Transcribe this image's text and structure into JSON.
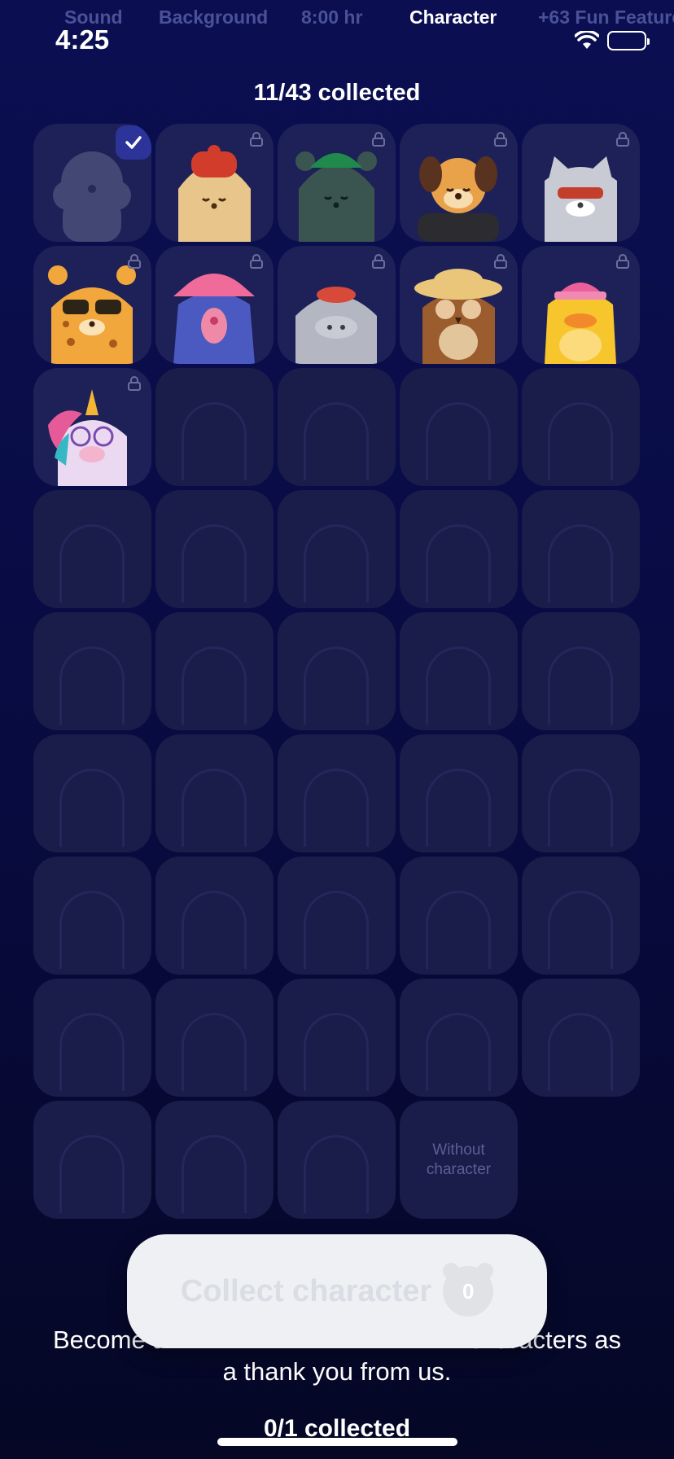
{
  "top_tabs": [
    {
      "label": "Sound",
      "active": false
    },
    {
      "label": "Background",
      "active": false
    },
    {
      "label": "8:00 hr",
      "active": false
    },
    {
      "label": "Character",
      "active": true
    },
    {
      "label": "+63 Fun Features",
      "active": false
    }
  ],
  "status_bar": {
    "time": "4:25"
  },
  "collection": {
    "title": "11/43 collected"
  },
  "characters": [
    {
      "name": "gray-poodle",
      "state": "selected"
    },
    {
      "name": "hedgehog-red-beanie",
      "state": "locked"
    },
    {
      "name": "panther-green-cap",
      "state": "locked"
    },
    {
      "name": "dog-leather-jacket",
      "state": "locked"
    },
    {
      "name": "cat-sunglasses",
      "state": "locked"
    },
    {
      "name": "leopard-glasses",
      "state": "locked"
    },
    {
      "name": "blue-bird-pink-hat",
      "state": "locked"
    },
    {
      "name": "hippo-red-beret",
      "state": "locked"
    },
    {
      "name": "owl-straw-hat",
      "state": "locked"
    },
    {
      "name": "duck-pink-cap",
      "state": "locked"
    },
    {
      "name": "unicorn-round-glasses",
      "state": "locked"
    }
  ],
  "empty_slots": 31,
  "without_character": {
    "label": "Without character"
  },
  "collect_button": {
    "label": "Collect character",
    "count": "0"
  },
  "footer": {
    "text_left": "Become a",
    "text_right": "characters as",
    "line2": "a thank you from us.",
    "count": "0/1 collected"
  },
  "colors": {
    "background": "#0b0f52",
    "tile": "#1b1e4d",
    "check_badge": "#2c3399",
    "button": "#eef0f3"
  }
}
